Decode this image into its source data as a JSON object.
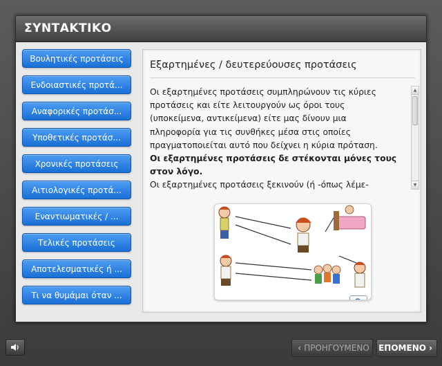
{
  "window": {
    "title": "ΣΥΝΤΑΚΤΙΚΟ"
  },
  "sidebar": {
    "items": [
      {
        "label": "Βουλητικές προτάσεις"
      },
      {
        "label": "Ενδοιαστικές προτά..."
      },
      {
        "label": "Αναφορικές προτάσ..."
      },
      {
        "label": "Υποθετικές προτάσ..."
      },
      {
        "label": "Χρονικές προτάσεις"
      },
      {
        "label": "Αιτιολογικές προτά..."
      },
      {
        "label": "Εναντιωματικές / ..."
      },
      {
        "label": "Τελικές προτάσεις"
      },
      {
        "label": "Αποτελεσματικές ή ..."
      },
      {
        "label": "Τι να θυμάμαι όταν ..."
      }
    ]
  },
  "content": {
    "title": "Εξαρτημένες / δευτερεύουσες προτάσεις",
    "paragraph1": "Οι εξαρτημένες προτάσεις συμπληρώνουν τις κύριες προτάσεις και είτε λειτουργούν ως όροι τους (υποκείμενα, αντικείμενα) είτε μας δίνουν μια πληροφορία για τις συνθήκες μέσα στις οποίες πραγματοποιείται αυτό που δείχνει η κύρια πρόταση.",
    "paragraph2_bold": "Οι εξαρτημένες προτάσεις δε στέκονται μόνες τους στον λόγο.",
    "paragraph3": "Οι εξαρτημένες προτάσεις ξεκινούν (ή -όπως λέμε-",
    "zoom_icon": "magnifier-icon"
  },
  "footer": {
    "audio_icon": "speaker-icon",
    "prev_label": "ΠΡΟΗΓΟΥΜΕΝΟ",
    "next_label": "ΕΠΟΜΕΝΟ"
  },
  "colors": {
    "button_blue": "#1a6fd6",
    "frame_dark": "#3b3b3b"
  }
}
